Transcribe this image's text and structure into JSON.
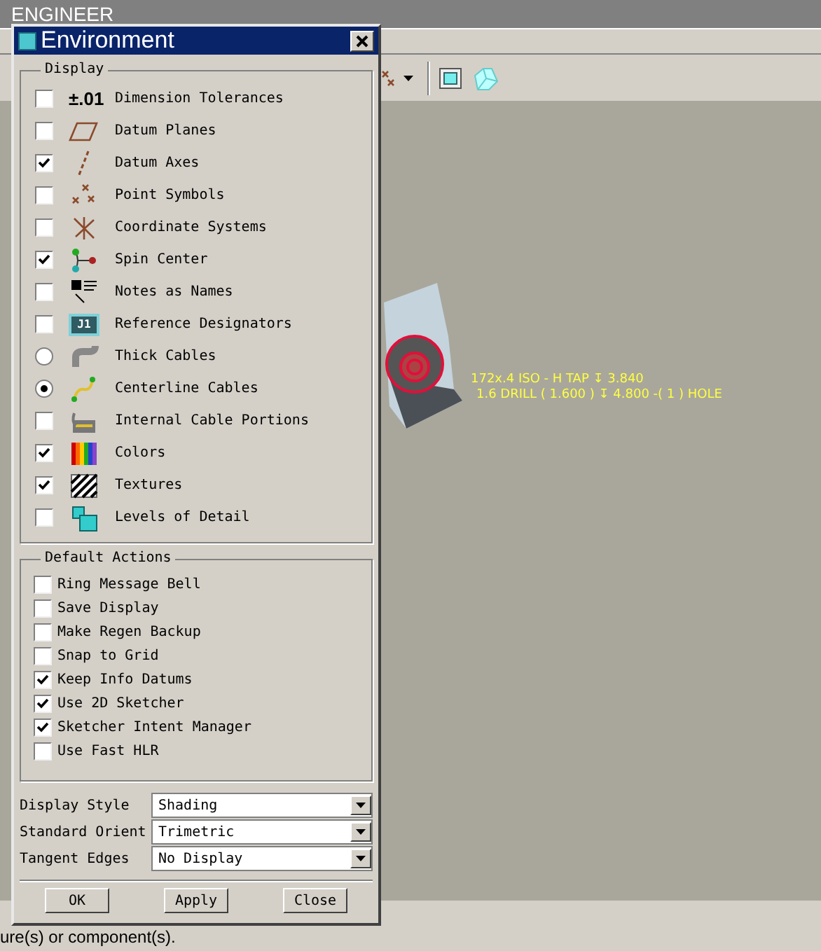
{
  "app": {
    "title": "ENGINEER",
    "status_message": "ure(s) or component(s).",
    "annotations": [
      "172x.4 ISO - H TAP ↧ 3.840",
      "1.6 DRILL ( 1.600 ) ↧ 4.800  -( 1 ) HOLE"
    ]
  },
  "dialog": {
    "title": "Environment",
    "display": {
      "label": "Display",
      "items": [
        {
          "kind": "checkbox",
          "icon_text": "±.01",
          "label": "Dimension Tolerances",
          "checked": false
        },
        {
          "kind": "checkbox",
          "label": "Datum Planes",
          "checked": false
        },
        {
          "kind": "checkbox",
          "label": "Datum Axes",
          "checked": true
        },
        {
          "kind": "checkbox",
          "label": "Point Symbols",
          "checked": false
        },
        {
          "kind": "checkbox",
          "label": "Coordinate Systems",
          "checked": false
        },
        {
          "kind": "checkbox",
          "label": "Spin Center",
          "checked": true
        },
        {
          "kind": "checkbox",
          "label": "Notes as Names",
          "checked": false
        },
        {
          "kind": "checkbox",
          "icon_text": "J1",
          "label": "Reference Designators",
          "checked": false
        },
        {
          "kind": "radio",
          "label": "Thick Cables",
          "selected": false
        },
        {
          "kind": "radio",
          "label": "Centerline Cables",
          "selected": true
        },
        {
          "kind": "checkbox",
          "label": "Internal Cable Portions",
          "checked": false
        },
        {
          "kind": "checkbox",
          "label": "Colors",
          "checked": true
        },
        {
          "kind": "checkbox",
          "label": "Textures",
          "checked": true
        },
        {
          "kind": "checkbox",
          "label": "Levels of Detail",
          "checked": false
        }
      ]
    },
    "default_actions": {
      "label": "Default Actions",
      "items": [
        {
          "label": "Ring Message Bell",
          "checked": false
        },
        {
          "label": "Save Display",
          "checked": false
        },
        {
          "label": "Make Regen Backup",
          "checked": false
        },
        {
          "label": "Snap to Grid",
          "checked": false
        },
        {
          "label": "Keep Info Datums",
          "checked": true
        },
        {
          "label": "Use 2D Sketcher",
          "checked": true
        },
        {
          "label": "Sketcher Intent Manager",
          "checked": true
        },
        {
          "label": "Use Fast HLR",
          "checked": false
        }
      ]
    },
    "settings": [
      {
        "label": "Display Style",
        "value": "Shading"
      },
      {
        "label": "Standard Orient",
        "value": "Trimetric"
      },
      {
        "label": "Tangent Edges",
        "value": "No Display"
      }
    ],
    "buttons": [
      "OK",
      "Apply",
      "Close"
    ]
  }
}
